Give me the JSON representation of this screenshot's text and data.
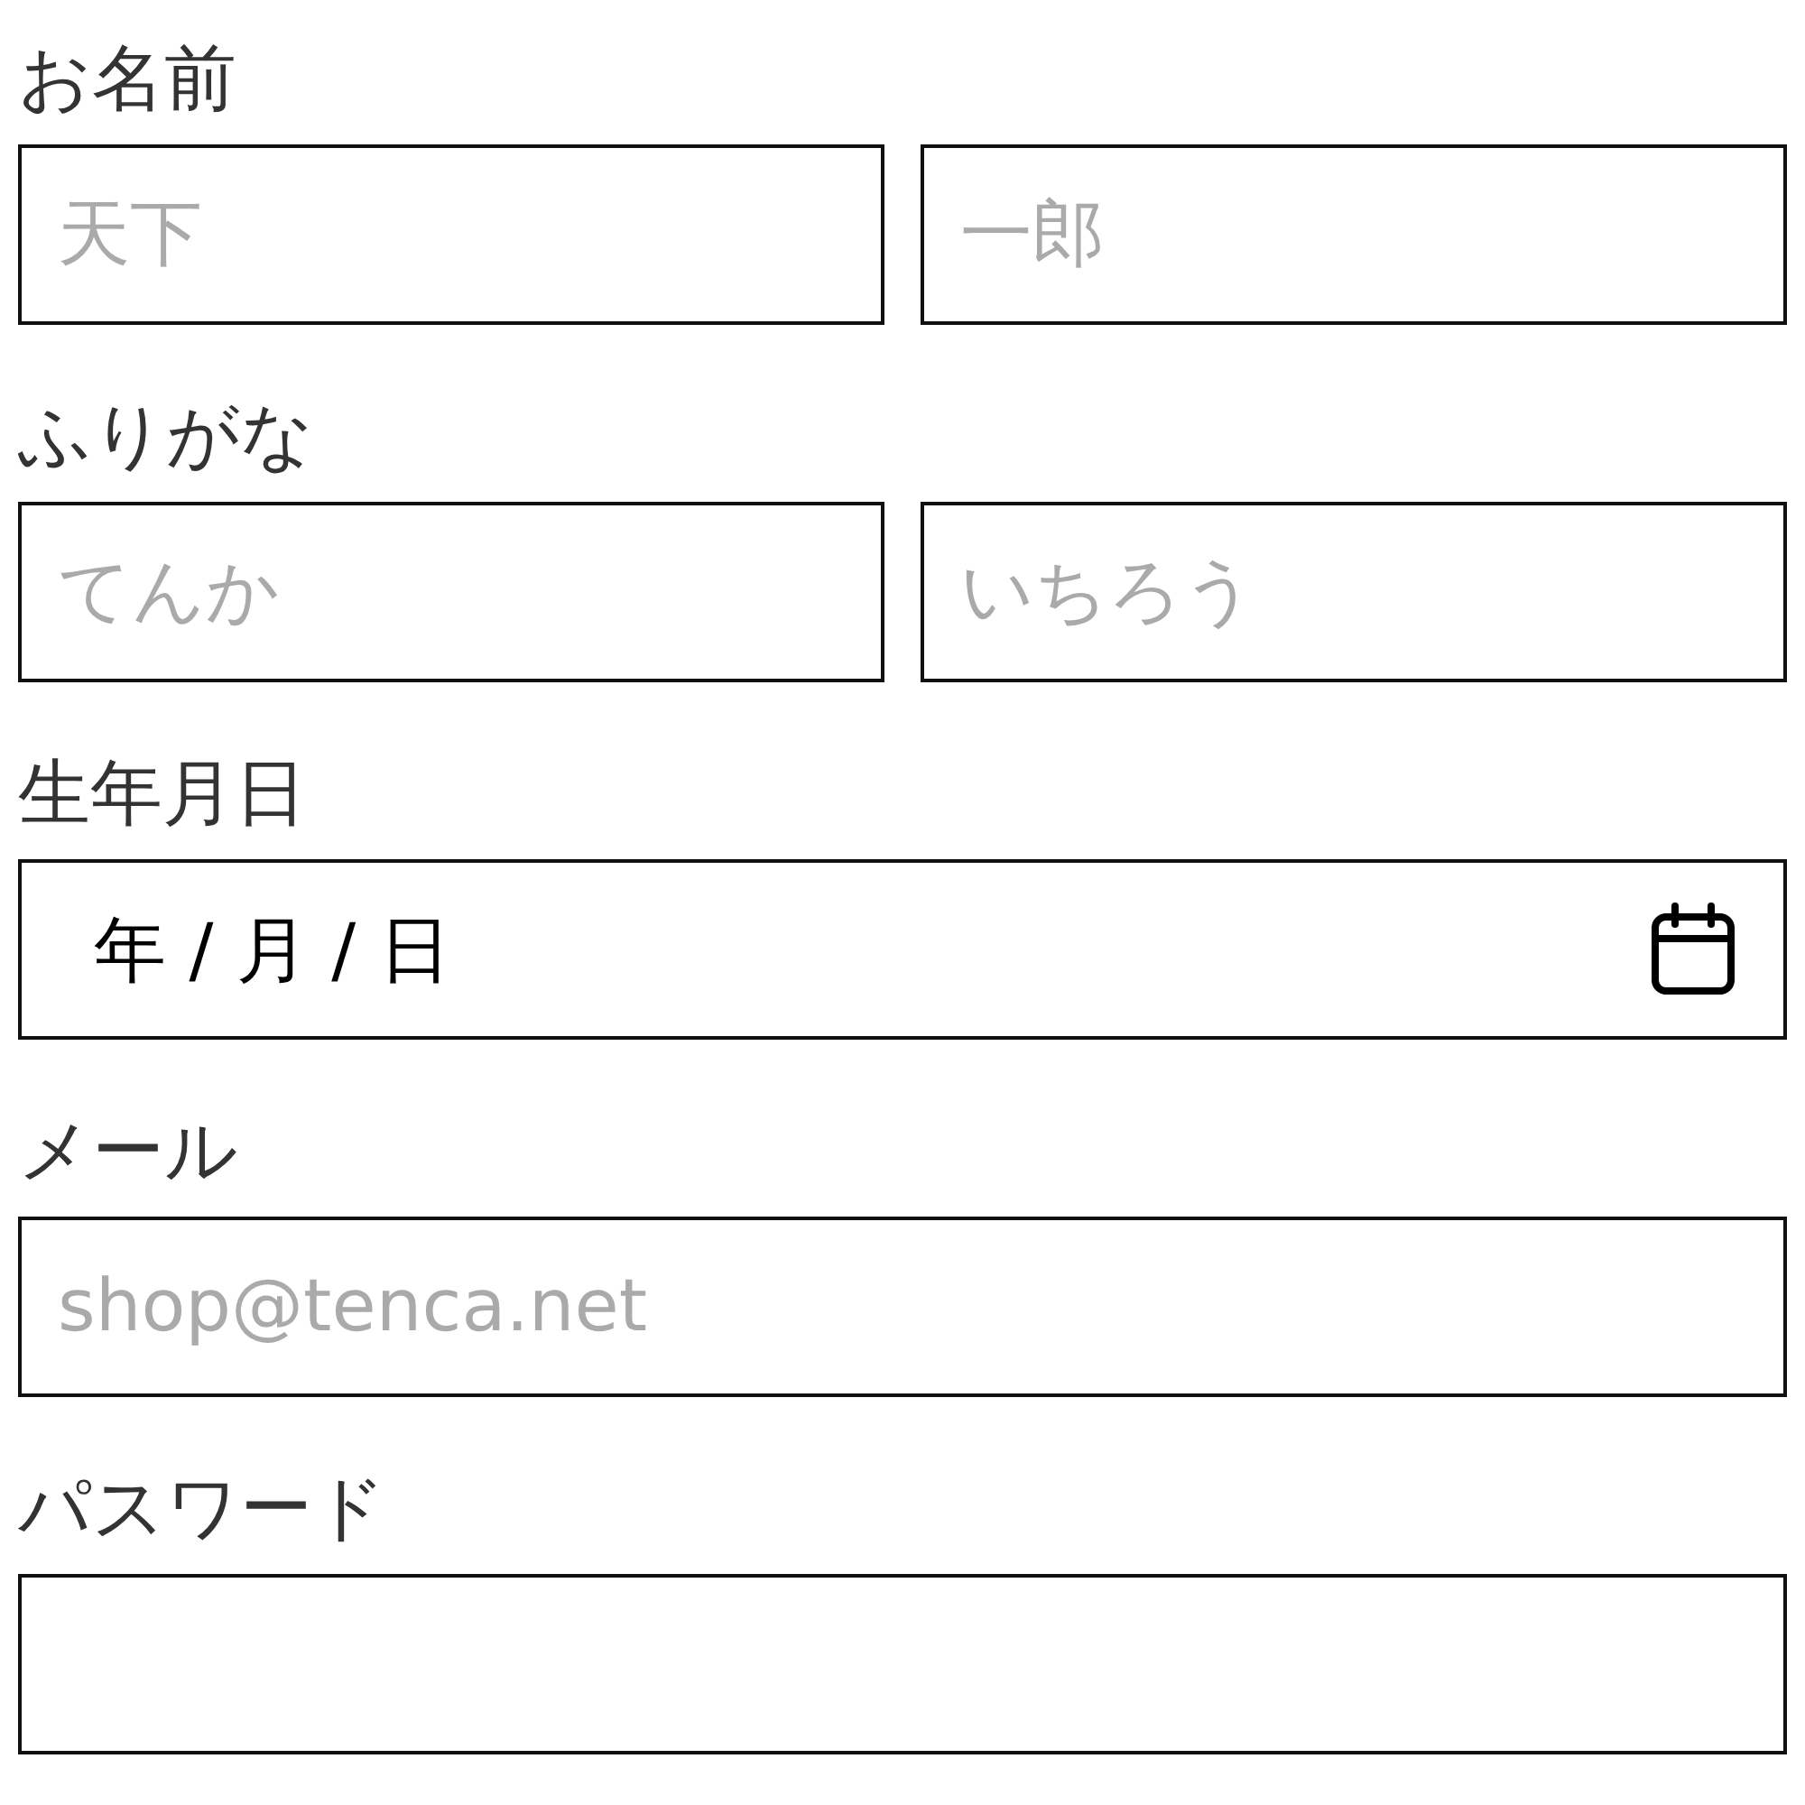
{
  "sections": [
    {
      "kind": "pair",
      "label": "お名前",
      "fields": [
        {
          "placeholder": "天下"
        },
        {
          "placeholder": "一郎"
        }
      ]
    },
    {
      "kind": "pair",
      "label": "ふりがな",
      "fields": [
        {
          "placeholder": "てんか"
        },
        {
          "placeholder": "いちろう"
        }
      ]
    },
    {
      "kind": "date",
      "label": "生年月日",
      "value": "年 / 月 / 日"
    },
    {
      "kind": "email",
      "label": "メール",
      "placeholder": "shop@tenca.net"
    },
    {
      "kind": "password",
      "label": "パスワード"
    }
  ]
}
